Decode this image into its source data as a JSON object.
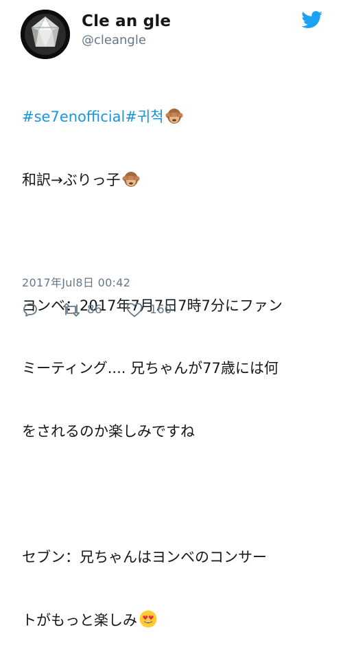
{
  "tweet": {
    "display_name": "Cle an gle",
    "handle": "@cleangle",
    "lines": {
      "l1_hashtag1": "#se7enofficial",
      "l1_hashtag2": "#귀척",
      "l2": "和訳→ぶりっ子",
      "l3": "",
      "l4": "ヨンベ：2017年7月7日7時7分にファン",
      "l5": "ミーティング.... 兄ちゃんが77歳には何",
      "l6": "をされるのか楽しみですね",
      "l7": "",
      "l8": "セブン：兄ちゃんはヨンベのコンサー",
      "l9": "トがもっと楽しみ"
    },
    "emojis": {
      "e1": "see-no-evil-monkey",
      "e2": "see-no-evil-monkey",
      "e3": "heart-eyes-face"
    },
    "timestamp": "2017年Jul8日 00:42",
    "retweet_count": "86",
    "like_count": "160"
  },
  "colors": {
    "link": "#1b95e0",
    "secondary_text": "#657786",
    "twitter_blue": "#1da1f2"
  }
}
